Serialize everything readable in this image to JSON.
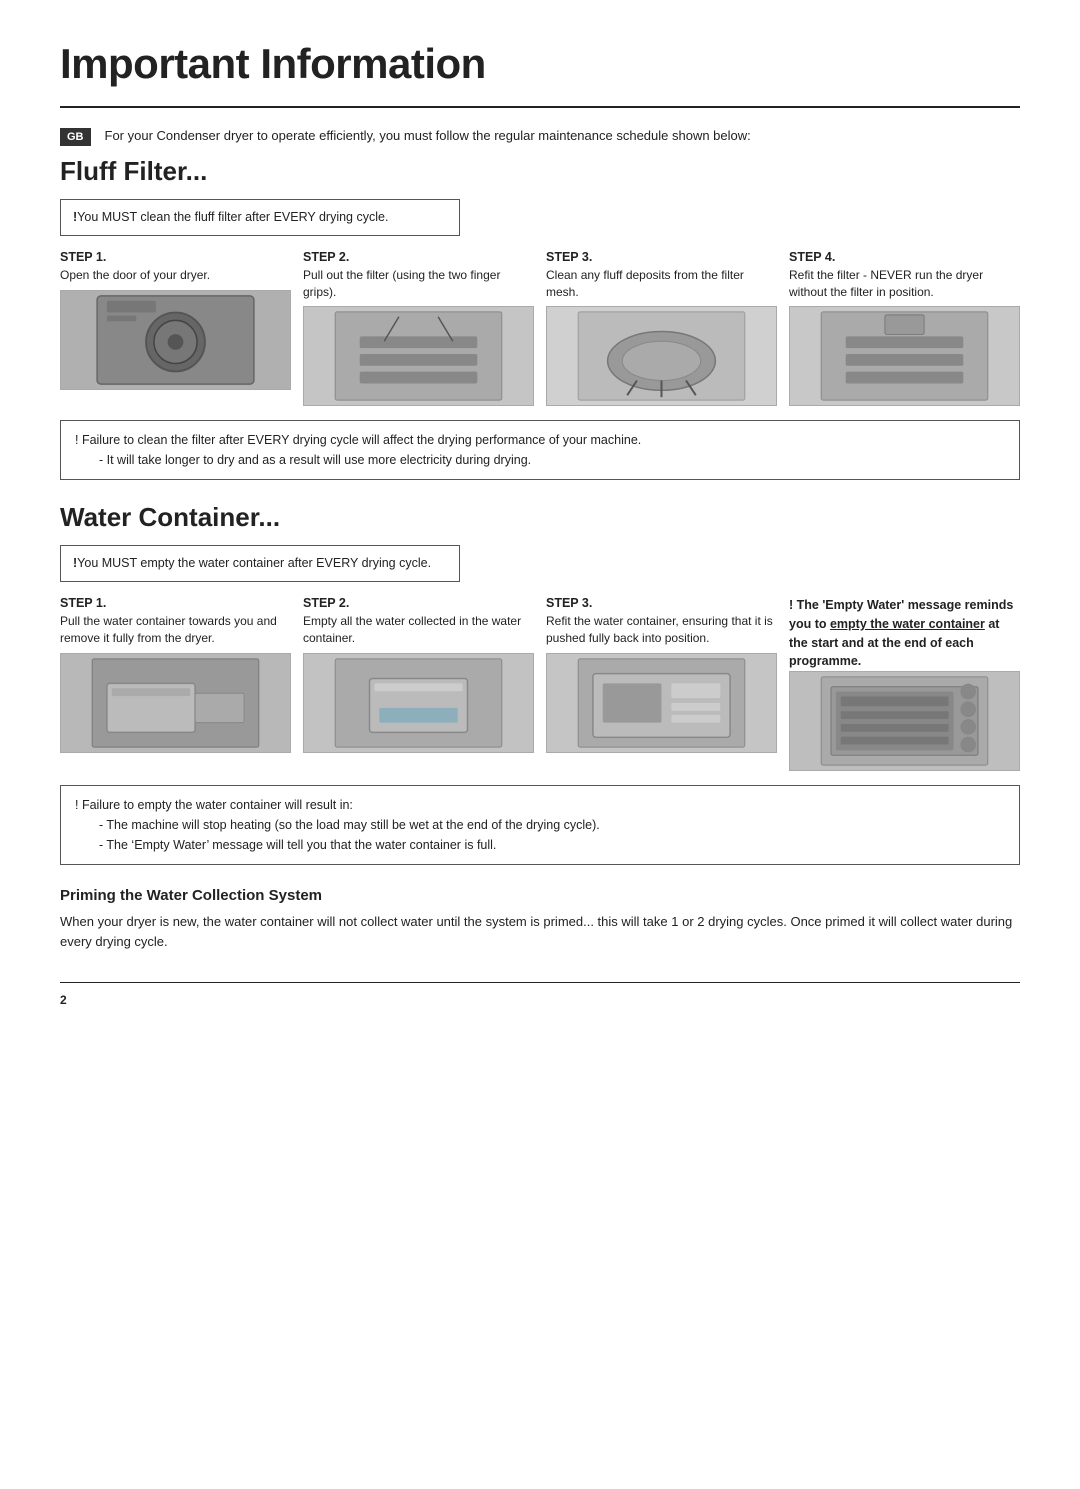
{
  "page": {
    "title": "Important Information",
    "page_number": "2"
  },
  "gb_label": "GB",
  "intro": "For your Condenser dryer to operate efficiently, you must follow the regular maintenance schedule shown below:",
  "fluff_filter": {
    "title": "Fluff Filter...",
    "warning": {
      "exclaim": "!",
      "text": "You MUST clean the fluff filter after EVERY drying cycle."
    },
    "steps": [
      {
        "label": "STEP 1.",
        "desc": "Open the door of your dryer.",
        "img_class": "img-dryer-front"
      },
      {
        "label": "STEP 2.",
        "desc": "Pull out the filter (using the two finger grips).",
        "img_class": "img-filter-pull"
      },
      {
        "label": "STEP 3.",
        "desc": "Clean any fluff deposits from the filter mesh.",
        "img_class": "img-filter-clean"
      },
      {
        "label": "STEP 4.",
        "desc": "Refit the filter - NEVER run the dryer without the filter in position.",
        "img_class": "img-filter-refit"
      }
    ],
    "notice": {
      "main": "! Failure to clean the filter after EVERY drying cycle will affect the drying performance of your machine.",
      "bullets": [
        "It will take longer to dry and as a result will use more electricity during drying."
      ]
    }
  },
  "water_container": {
    "title": "Water Container...",
    "warning": {
      "exclaim": "!",
      "text": "You MUST empty the water container after EVERY drying cycle."
    },
    "steps": [
      {
        "label": "STEP 1.",
        "desc": "Pull the water container towards you and remove it fully from the dryer.",
        "img_class": "img-container-pull"
      },
      {
        "label": "STEP 2.",
        "desc": "Empty all the water collected in the water container.",
        "img_class": "img-container-empty"
      },
      {
        "label": "STEP 3.",
        "desc": "Refit the water container, ensuring that it is pushed fully back into position.",
        "img_class": "img-container-refit"
      },
      {
        "special": true,
        "special_text_1": "! The ‘Empty Water’",
        "special_text_2": "message reminds you to empty the water container at the start and at the end of each programme.",
        "img_class": "img-panel"
      }
    ],
    "notice": {
      "main": "! Failure to empty the water container will result in:",
      "bullets": [
        "The machine will stop heating (so the load may still be wet at the end of the drying cycle).",
        "The ‘Empty Water’ message will tell you that the water container is full."
      ]
    },
    "priming": {
      "title": "Priming the Water Collection System",
      "text": "When your dryer is new, the water container will not collect water until the system is primed... this will take 1 or 2 drying cycles. Once primed it will collect water during every drying cycle."
    }
  }
}
